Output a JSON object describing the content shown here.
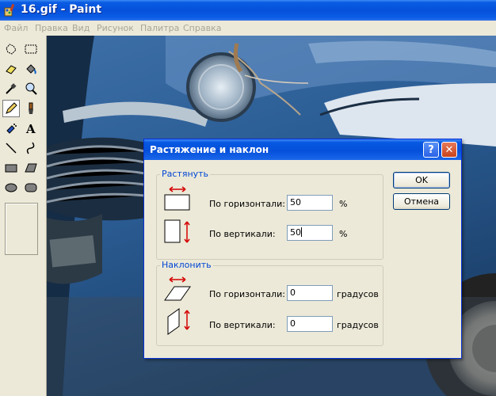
{
  "window": {
    "title": "16.gif - Paint"
  },
  "menu": [
    "Файл",
    "Правка",
    "Вид",
    "Рисунок",
    "Палитра",
    "Справка"
  ],
  "tools": [
    "free-form-select-icon",
    "select-icon",
    "eraser-icon",
    "fill-icon",
    "color-picker-icon",
    "magnifier-icon",
    "pencil-icon",
    "brush-icon",
    "airbrush-icon",
    "text-icon",
    "line-icon",
    "curve-icon",
    "rectangle-icon",
    "polygon-icon",
    "ellipse-icon",
    "rounded-rectangle-icon"
  ],
  "dialog": {
    "title": "Растяжение и наклон",
    "help": "?",
    "close": "✕",
    "stretch": {
      "label": "Растянуть",
      "horizontal_label": "По горизонтали:",
      "horizontal_value": "50",
      "vertical_label": "По вертикали:",
      "vertical_value": "50",
      "unit": "%"
    },
    "skew": {
      "label": "Наклонить",
      "horizontal_label": "По горизонтали:",
      "horizontal_value": "0",
      "vertical_label": "По вертикали:",
      "vertical_value": "0",
      "unit": "градусов"
    },
    "ok": "OK",
    "cancel": "Отмена"
  },
  "colors": {
    "accent": "#0046d5",
    "titlebar": "#0550da",
    "arrow": "#d40000"
  }
}
